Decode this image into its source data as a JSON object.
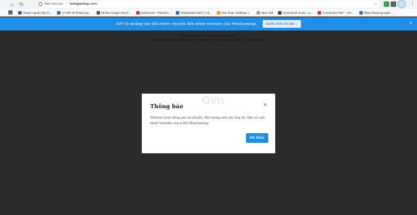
{
  "browser": {
    "secure_label": "Not secure",
    "url": "mixigaming.com",
    "bookmarks": [
      {
        "label": "Share nguồn lấy Pr...",
        "color": "#3b5998"
      },
      {
        "label": "Ai biết về Rotoscop...",
        "color": "#4267b2"
      },
      {
        "label": "Online Image Resiz...",
        "color": "#555555"
      },
      {
        "label": "Subscene - Passion...",
        "color": "#d93025"
      },
      {
        "label": "WapMaker.NET | Cá...",
        "color": "#1a73e8"
      },
      {
        "label": "Get nhạc 320kbps t...",
        "color": "#f29900"
      },
      {
        "label": "New Tab",
        "color": "#9aa0a6"
      },
      {
        "label": "Download music, m...",
        "color": "#3c4043"
      },
      {
        "label": "Compress PDF – Re...",
        "color": "#d93025"
      },
      {
        "label": "https://www.google....",
        "color": "#1a73e8"
      }
    ]
  },
  "promo": {
    "text": "API và quảng cáo đều được chuyển đến kênh youtube của MixiGaming.",
    "button_label": "XEM YOUTUBE ›",
    "close_glyph": "×"
  },
  "page": {
    "line1": "This account has been suspended.",
    "line2": "Either the domain has been overused, or the reseller ran out of resources."
  },
  "modal": {
    "title": "Thông báo",
    "close_glyph": "×",
    "body": "Website hoạt động phi lợi nhuận. Rất mong anh em ủng hộ, like và sub kênh Youtube của A Độ MixiGaming",
    "button_label": "Đã Hiểu",
    "watermark": "Gvn"
  }
}
